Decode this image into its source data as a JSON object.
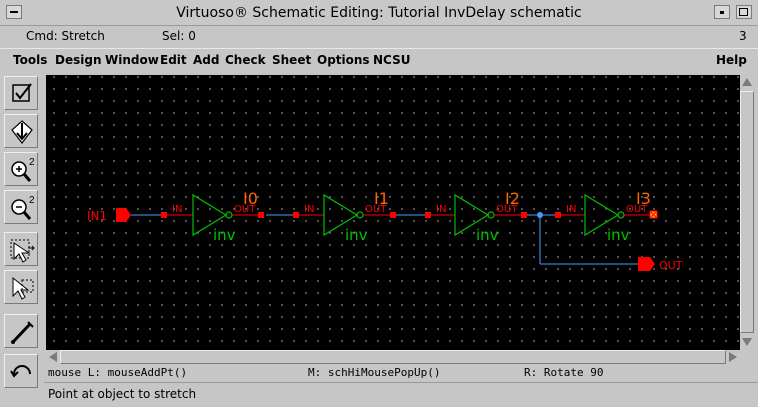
{
  "window": {
    "title": "Virtuoso® Schematic Editing: Tutorial InvDelay schematic"
  },
  "status": {
    "cmd": "Cmd: Stretch",
    "sel": "Sel: 0",
    "count": "3"
  },
  "menu": {
    "items": [
      "Tools",
      "Design",
      "Window",
      "Edit",
      "Add",
      "Check",
      "Sheet",
      "Options",
      "NCSU"
    ],
    "help": "Help"
  },
  "toolbox": {
    "icons": [
      "check-save-icon",
      "descend-icon",
      "zoom-in-icon",
      "zoom-out-icon",
      "stretch-icon",
      "copy-icon",
      "wire-icon",
      "undo-icon"
    ],
    "zoom_in_factor": "2",
    "zoom_out_factor": "2"
  },
  "schematic": {
    "input_pin": "IN1",
    "output_pin": "OUT",
    "pin_in_label": "IN",
    "pin_out_label": "OUT",
    "cell_name": "inv",
    "instances": [
      "I0",
      "I1",
      "I2",
      "I3"
    ],
    "colors": {
      "pin": "#ff0000",
      "gate": "#00c000",
      "wire": "#40a0ff",
      "instance_name": "#ff6600"
    }
  },
  "mouse": {
    "left": "mouse L: mouseAddPt()",
    "middle": "M: schHiMousePopUp()",
    "right": "R: Rotate 90"
  },
  "prompt": "Point at object to stretch"
}
